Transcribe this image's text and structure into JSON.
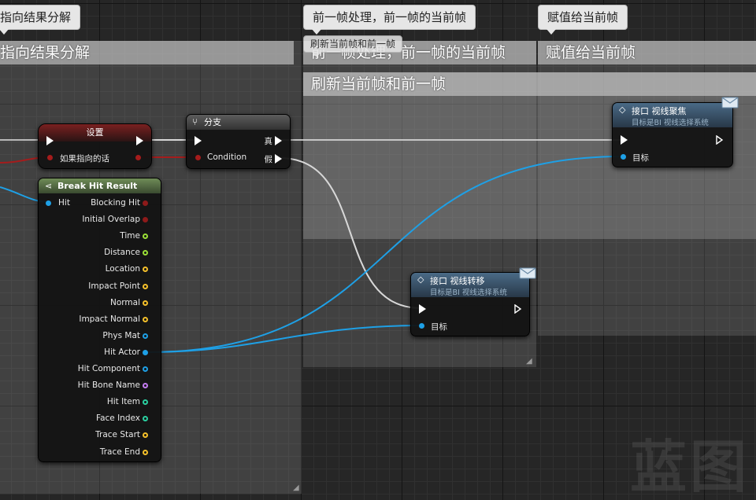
{
  "comments": {
    "left_bubble": "指向结果分解",
    "left_header": "指向结果分解",
    "mid_bubble": "前一帧处理，前一帧的当前帧",
    "mid_header": "前一帧处理，前一帧的当前帧",
    "mid_small_header": "刷新当前帧和前一帧",
    "inner_header": "刷新当前帧和前一帧",
    "right_bubble": "赋值给当前帧",
    "right_header": "赋值给当前帧"
  },
  "nodes": {
    "set": {
      "title": "设置",
      "pin_label": "如果指向的话"
    },
    "branch": {
      "title": "分支",
      "condition_label": "Condition",
      "true_label": "真",
      "false_label": "假"
    },
    "break_hit": {
      "title": "Break Hit Result",
      "input_pin": "Hit",
      "outputs": [
        {
          "label": "Blocking Hit",
          "color": "#8e1a1a",
          "filled": true
        },
        {
          "label": "Initial Overlap",
          "color": "#8e1a1a",
          "filled": true
        },
        {
          "label": "Time",
          "color": "#9be037",
          "filled": false
        },
        {
          "label": "Distance",
          "color": "#9be037",
          "filled": false
        },
        {
          "label": "Location",
          "color": "#f5c02a",
          "filled": false
        },
        {
          "label": "Impact Point",
          "color": "#f5c02a",
          "filled": false
        },
        {
          "label": "Normal",
          "color": "#f5c02a",
          "filled": false
        },
        {
          "label": "Impact Normal",
          "color": "#f5c02a",
          "filled": false
        },
        {
          "label": "Phys Mat",
          "color": "#1ea0e6",
          "filled": false
        },
        {
          "label": "Hit Actor",
          "color": "#1ea0e6",
          "filled": true
        },
        {
          "label": "Hit Component",
          "color": "#1ea0e6",
          "filled": false
        },
        {
          "label": "Hit Bone Name",
          "color": "#c37cf0",
          "filled": false
        },
        {
          "label": "Hit Item",
          "color": "#2ad0a0",
          "filled": false
        },
        {
          "label": "Face Index",
          "color": "#2ad0a0",
          "filled": false
        },
        {
          "label": "Trace Start",
          "color": "#f5c02a",
          "filled": false
        },
        {
          "label": "Trace End",
          "color": "#f5c02a",
          "filled": false
        }
      ]
    },
    "focus": {
      "title": "接口 视线聚焦",
      "subtitle": "目标是BI 视线选择系统",
      "target_label": "目标"
    },
    "shift": {
      "title": "接口 视线转移",
      "subtitle": "目标是BI 视线选择系统",
      "target_label": "目标"
    }
  },
  "watermark": "蓝图",
  "colors": {
    "exec": "#ffffff",
    "bool": "#8e1a1a",
    "object": "#1ea0e6",
    "wire_exec": "#d8d8d8"
  }
}
